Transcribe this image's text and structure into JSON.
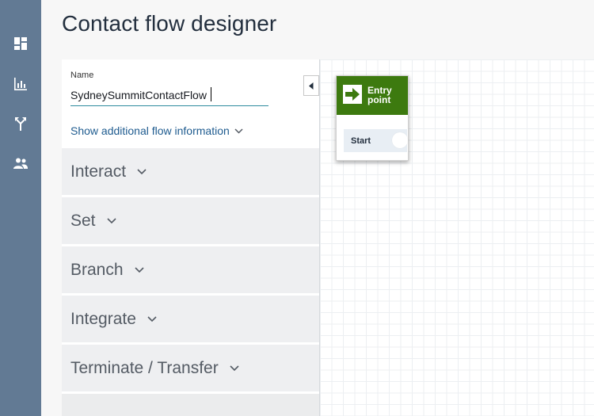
{
  "header": {
    "title": "Contact flow designer"
  },
  "nav": {
    "items": [
      {
        "icon": "dashboard-icon"
      },
      {
        "icon": "metrics-icon"
      },
      {
        "icon": "routing-icon"
      },
      {
        "icon": "users-icon"
      }
    ]
  },
  "flow": {
    "name_label": "Name",
    "name_value": "SydneySummitContactFlow",
    "show_info_label": "Show additional flow information"
  },
  "categories": [
    {
      "label": "Interact"
    },
    {
      "label": "Set"
    },
    {
      "label": "Branch"
    },
    {
      "label": "Integrate"
    },
    {
      "label": "Terminate / Transfer"
    }
  ],
  "entry_block": {
    "title": "Entry point",
    "start_label": "Start",
    "header_color": "#3d7a0f"
  },
  "colors": {
    "rail": "#627a94",
    "link": "#1e5b8f"
  }
}
